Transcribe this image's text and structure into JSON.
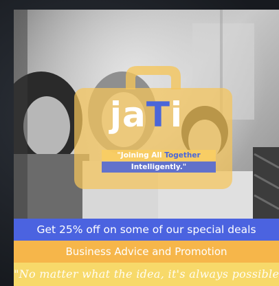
{
  "logo": {
    "word_part1": "ja",
    "word_part2": "T",
    "word_part3": "i",
    "tagline_part1": "\"Joining All ",
    "tagline_part2": "Together",
    "tagline_line2": "Intelligently.\""
  },
  "banners": {
    "deal": "Get 25% off on some of our special deals",
    "service": "Business Advice and Promotion",
    "quote": "\"No matter what the idea, it's always possible"
  },
  "colors": {
    "blue": "#4b63e0",
    "orange": "#f6b64a",
    "yellow": "#f7d96a"
  }
}
